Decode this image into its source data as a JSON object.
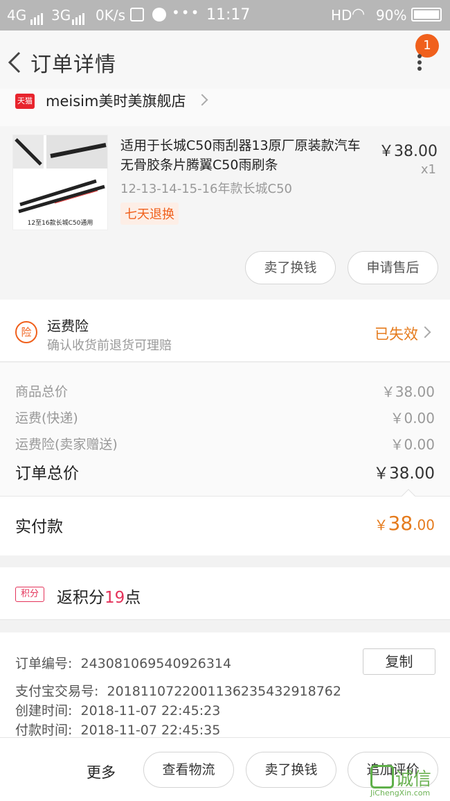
{
  "status_bar": {
    "carrier1": "4G",
    "carrier2": "3G",
    "speed": "0K/s",
    "time": "11:17",
    "hd": "HD",
    "battery": "90%"
  },
  "header": {
    "title": "订单详情",
    "badge_count": "1"
  },
  "store": {
    "icon_text": "天猫",
    "name": "meisim美时美旗舰店"
  },
  "product": {
    "image_caption": "12至16款长城C50通用",
    "title": "适用于长城C50雨刮器13原厂原装款汽车无骨胶条片腾翼C50雨刷条",
    "price": "￥38.00",
    "qty": "x1",
    "sku": "12-13-14-15-16年款长城C50",
    "tag": "七天退换",
    "btn_sell": "卖了换钱",
    "btn_aftersale": "申请售后"
  },
  "insurance": {
    "icon": "险",
    "title": "运费险",
    "subtitle": "确认收货前退货可理赔",
    "status": "已失效"
  },
  "summary": {
    "goods_label": "商品总价",
    "goods_value": "￥38.00",
    "ship_label": "运费(快递)",
    "ship_value": "￥0.00",
    "ins_label": "运费险(卖家赠送)",
    "ins_value": "￥0.00",
    "total_label": "订单总价",
    "total_value": "￥38.00"
  },
  "paid": {
    "label": "实付款",
    "currency": "￥",
    "integer": "38",
    "decimal": ".00"
  },
  "points": {
    "icon": "积分",
    "prefix": "返积分",
    "num": "19",
    "suffix": "点"
  },
  "order_info": {
    "order_no_label": "订单编号:",
    "order_no": "243081069540926314",
    "copy": "复制",
    "alipay_label": "支付宝交易号:",
    "alipay_no": "2018110722001136235432918762",
    "created_label": "创建时间:",
    "created": "2018-11-07 22:45:23",
    "paid_label": "付款时间:",
    "paid": "2018-11-07 22:45:35"
  },
  "bottom": {
    "more": "更多",
    "logistics": "查看物流",
    "sell": "卖了换钱",
    "review": "追加评价"
  },
  "watermark": {
    "cn": "诚信",
    "en": "JiChengXin.com"
  }
}
